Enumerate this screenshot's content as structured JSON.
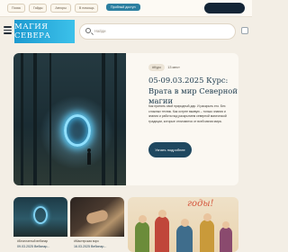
{
  "topbar": {
    "links": [
      "Поиск",
      "Гайды",
      "Авторы",
      "В помощь"
    ],
    "cta": "Пробный доступ"
  },
  "header": {
    "logo_text": "МАГИЯ СЕВЕРА",
    "search_placeholder": "Найди"
  },
  "hero": {
    "tags": [
      "#Курс",
      "13 мест"
    ],
    "title": "05-09.03.2025 Курс: Врата в мир Северной магии",
    "description": "Как принять свой природный дар. И раскрыть его. Без сложных техник. Как острее вживую – только знания и знания и работа над раскрытием северной магической традиции, которые отличаются от всей магии мира.",
    "button": "Узнать подробнее"
  },
  "cards": [
    {
      "tag": "#Бесплатный вебинар",
      "date": "09.03.2025 Вебинар..."
    },
    {
      "tag": "#Мастерская ворс",
      "date": "16.03.2025 Вебинар..."
    },
    {
      "caption": "годы!"
    }
  ],
  "colors": {
    "accent": "#2c7fa0",
    "logo": "#1c9ad0",
    "button": "#1f4860",
    "background": "#f3eee5"
  }
}
